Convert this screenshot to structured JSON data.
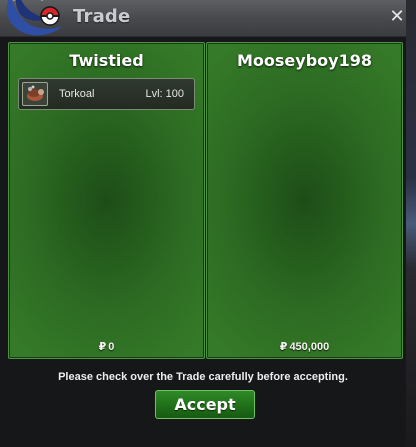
{
  "window": {
    "title": "Trade",
    "close_icon": "close-icon"
  },
  "trade": {
    "left": {
      "player_name": "Twistied",
      "items": [
        {
          "name": "Torkoal",
          "level": "Lvl: 100",
          "icon": "torkoal-icon"
        }
      ],
      "currency_symbol": "₽",
      "currency_amount": "0"
    },
    "right": {
      "player_name": "Mooseyboy198",
      "items": [],
      "currency_symbol": "₽",
      "currency_amount": "450,000"
    }
  },
  "footer": {
    "notice": "Please check over the Trade carefully before accepting.",
    "accept_label": "Accept"
  },
  "colors": {
    "panel_green": "#2c6a22",
    "button_green": "#1f6d18",
    "titlebar_gray": "#46484c"
  }
}
